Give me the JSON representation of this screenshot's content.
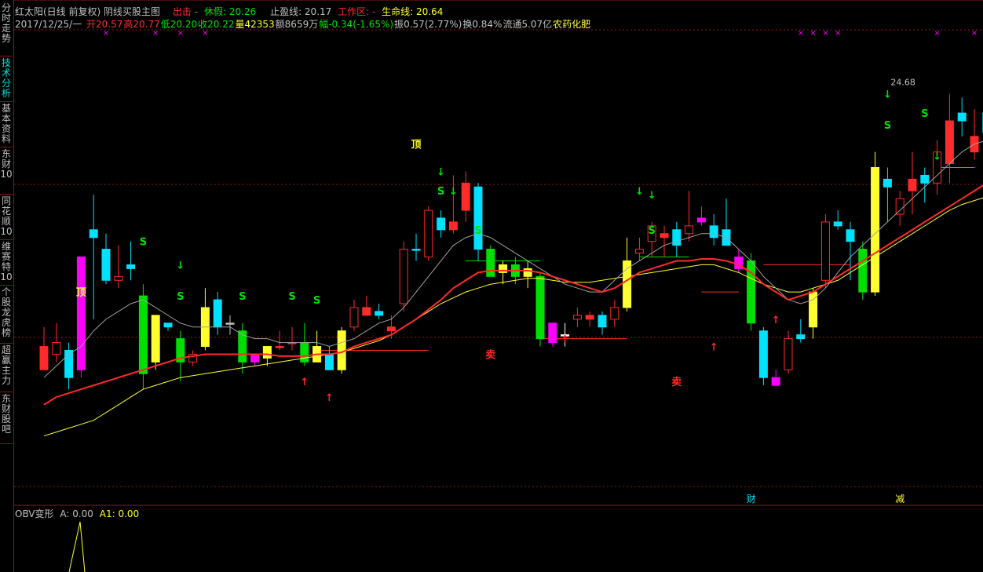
{
  "colors": {
    "red": "#ff2a2a",
    "yellow": "#ffff30",
    "green": "#00e000",
    "cyan": "#00e0ff",
    "magenta": "#ff00ff",
    "white": "#ffffff",
    "grey": "#c0c0c0",
    "axis": "#8a1a1a",
    "darkred": "#cc2020"
  },
  "sidebar": {
    "tabs": [
      "分时走势",
      "技术分析",
      "基本资料",
      "东财10",
      "同花顺10",
      "维赛特10",
      "个股龙虎榜",
      "超赢主力",
      "东财股吧"
    ],
    "active_index": 1
  },
  "header": {
    "title": "红太阳(日线 前复权) 阴线买股主图",
    "exit_label": "出击",
    "dash": "-",
    "rest_label": "休假: 20.26",
    "stop_label": "止盈线: 20.17",
    "work_label": "工作区: -",
    "life_label": "生命线: 20.64",
    "date": "2017/12/25/一",
    "open": "开20.57",
    "high": "高20.77",
    "low": "低20.20",
    "close": "收20.22",
    "vol": "量42353",
    "amount": "额8659万",
    "change": "幅-0.34(-1.65%)",
    "amp": "振0.57(2.77%)",
    "turnover": "换0.84%",
    "float": "流通5.07亿",
    "sector": "农药化肥"
  },
  "indicator": {
    "label": "OBV变形",
    "a": "A: 0.00",
    "a1": "A1: 0.00"
  },
  "chart_data": {
    "type": "candlestick",
    "title": "红太阳(日线 前复权) 阴线买股主图",
    "ylim": [
      14.2,
      25.9
    ],
    "max_label": "24.68",
    "candles": [
      {
        "o": 17.8,
        "h": 18.3,
        "l": 17.4,
        "c": 17.2,
        "col": "red"
      },
      {
        "o": 17.6,
        "h": 18.4,
        "l": 17.4,
        "c": 17.9,
        "col": "red"
      },
      {
        "o": 17.7,
        "h": 17.9,
        "l": 16.7,
        "c": 17.0,
        "col": "cyan"
      },
      {
        "o": 17.2,
        "h": 17.3,
        "l": 17.0,
        "c": 20.1,
        "col": "magenta"
      },
      {
        "o": 20.8,
        "h": 21.7,
        "l": 18.5,
        "c": 20.6,
        "col": "cyan"
      },
      {
        "o": 20.3,
        "h": 20.7,
        "l": 19.4,
        "c": 19.5,
        "col": "cyan"
      },
      {
        "o": 19.5,
        "h": 20.4,
        "l": 19.3,
        "c": 19.6,
        "col": "red"
      },
      {
        "o": 19.8,
        "h": 20.5,
        "l": 19.5,
        "c": 19.9,
        "col": "cyan"
      },
      {
        "o": 19.1,
        "h": 19.4,
        "l": 16.7,
        "c": 17.1,
        "col": "green"
      },
      {
        "o": 18.6,
        "h": 18.6,
        "l": 17.2,
        "c": 17.4,
        "col": "yellow"
      },
      {
        "o": 18.4,
        "h": 18.4,
        "l": 18.2,
        "c": 18.3,
        "col": "cyan"
      },
      {
        "o": 18.0,
        "h": 18.2,
        "l": 16.9,
        "c": 17.4,
        "col": "green"
      },
      {
        "o": 17.4,
        "h": 17.7,
        "l": 17.3,
        "c": 17.6,
        "col": "red"
      },
      {
        "o": 17.8,
        "h": 19.3,
        "l": 17.7,
        "c": 18.8,
        "col": "yellow"
      },
      {
        "o": 19.0,
        "h": 19.2,
        "l": 18.1,
        "c": 18.3,
        "col": "cyan"
      },
      {
        "o": 18.4,
        "h": 18.6,
        "l": 18.1,
        "c": 18.4,
        "col": "grey"
      },
      {
        "o": 18.2,
        "h": 18.4,
        "l": 17.1,
        "c": 17.4,
        "col": "green"
      },
      {
        "o": 17.6,
        "h": 17.6,
        "l": 17.3,
        "c": 17.4,
        "col": "magenta"
      },
      {
        "o": 17.5,
        "h": 17.7,
        "l": 17.3,
        "c": 17.8,
        "col": "yellow"
      },
      {
        "o": 17.8,
        "h": 18.2,
        "l": 17.7,
        "c": 17.8,
        "col": "red"
      },
      {
        "o": 17.9,
        "h": 18.3,
        "l": 17.7,
        "c": 17.9,
        "col": "red"
      },
      {
        "o": 17.9,
        "h": 18.4,
        "l": 17.3,
        "c": 17.4,
        "col": "green"
      },
      {
        "o": 17.8,
        "h": 18.2,
        "l": 17.4,
        "c": 17.4,
        "col": "yellow"
      },
      {
        "o": 17.6,
        "h": 17.8,
        "l": 17.2,
        "c": 17.2,
        "col": "cyan"
      },
      {
        "o": 17.2,
        "h": 18.3,
        "l": 17.1,
        "c": 18.2,
        "col": "yellow"
      },
      {
        "o": 18.3,
        "h": 19.0,
        "l": 18.2,
        "c": 18.8,
        "col": "red"
      },
      {
        "o": 18.8,
        "h": 19.1,
        "l": 18.6,
        "c": 18.6,
        "col": "red"
      },
      {
        "o": 18.6,
        "h": 18.9,
        "l": 18.5,
        "c": 18.7,
        "col": "cyan"
      },
      {
        "o": 18.3,
        "h": 18.6,
        "l": 18.0,
        "c": 18.2,
        "col": "red"
      },
      {
        "o": 18.9,
        "h": 20.5,
        "l": 18.7,
        "c": 20.3,
        "col": "red"
      },
      {
        "o": 20.3,
        "h": 20.7,
        "l": 20.0,
        "c": 20.3,
        "col": "cyan"
      },
      {
        "o": 20.1,
        "h": 21.4,
        "l": 20.0,
        "c": 21.3,
        "col": "red"
      },
      {
        "o": 21.1,
        "h": 21.3,
        "l": 20.6,
        "c": 20.8,
        "col": "cyan"
      },
      {
        "o": 21.0,
        "h": 22.2,
        "l": 20.7,
        "c": 20.8,
        "col": "red"
      },
      {
        "o": 22.0,
        "h": 22.3,
        "l": 21.0,
        "c": 21.3,
        "col": "red"
      },
      {
        "o": 21.9,
        "h": 22.0,
        "l": 20.0,
        "c": 20.3,
        "col": "cyan"
      },
      {
        "o": 20.3,
        "h": 20.4,
        "l": 19.6,
        "c": 19.6,
        "col": "green"
      },
      {
        "o": 19.9,
        "h": 20.0,
        "l": 19.4,
        "c": 19.7,
        "col": "yellow"
      },
      {
        "o": 19.9,
        "h": 20.1,
        "l": 19.4,
        "c": 19.6,
        "col": "green"
      },
      {
        "o": 19.8,
        "h": 20.0,
        "l": 19.3,
        "c": 19.6,
        "col": "yellow"
      },
      {
        "o": 19.6,
        "h": 19.7,
        "l": 17.8,
        "c": 18.0,
        "col": "green"
      },
      {
        "o": 18.4,
        "h": 18.4,
        "l": 17.8,
        "c": 17.9,
        "col": "magenta"
      },
      {
        "o": 18.1,
        "h": 18.4,
        "l": 17.8,
        "c": 18.1,
        "col": "white"
      },
      {
        "o": 18.5,
        "h": 18.8,
        "l": 18.3,
        "c": 18.6,
        "col": "red"
      },
      {
        "o": 18.6,
        "h": 18.7,
        "l": 18.3,
        "c": 18.5,
        "col": "red"
      },
      {
        "o": 18.3,
        "h": 18.7,
        "l": 18.1,
        "c": 18.6,
        "col": "cyan"
      },
      {
        "o": 18.5,
        "h": 19.0,
        "l": 18.3,
        "c": 18.8,
        "col": "red"
      },
      {
        "o": 18.8,
        "h": 20.6,
        "l": 18.7,
        "c": 20.0,
        "col": "yellow"
      },
      {
        "o": 20.2,
        "h": 20.6,
        "l": 20.0,
        "c": 20.3,
        "col": "red"
      },
      {
        "o": 20.5,
        "h": 21.0,
        "l": 20.1,
        "c": 20.9,
        "col": "red"
      },
      {
        "o": 20.7,
        "h": 20.9,
        "l": 20.1,
        "c": 20.6,
        "col": "red"
      },
      {
        "o": 20.8,
        "h": 21.0,
        "l": 20.1,
        "c": 20.4,
        "col": "cyan"
      },
      {
        "o": 20.7,
        "h": 21.8,
        "l": 20.5,
        "c": 20.9,
        "col": "red"
      },
      {
        "o": 21.1,
        "h": 21.4,
        "l": 20.9,
        "c": 21.0,
        "col": "magenta"
      },
      {
        "o": 20.9,
        "h": 21.2,
        "l": 20.4,
        "c": 20.6,
        "col": "cyan"
      },
      {
        "o": 20.8,
        "h": 21.6,
        "l": 20.4,
        "c": 20.4,
        "col": "cyan"
      },
      {
        "o": 20.1,
        "h": 20.3,
        "l": 19.7,
        "c": 19.8,
        "col": "magenta"
      },
      {
        "o": 20.0,
        "h": 20.2,
        "l": 18.2,
        "c": 18.4,
        "col": "green"
      },
      {
        "o": 18.2,
        "h": 18.3,
        "l": 16.8,
        "c": 17.0,
        "col": "cyan"
      },
      {
        "o": 17.0,
        "h": 17.2,
        "l": 16.8,
        "c": 16.8,
        "col": "magenta"
      },
      {
        "o": 17.2,
        "h": 18.2,
        "l": 17.1,
        "c": 18.0,
        "col": "red"
      },
      {
        "o": 18.1,
        "h": 18.5,
        "l": 17.9,
        "c": 18.0,
        "col": "cyan"
      },
      {
        "o": 18.3,
        "h": 19.3,
        "l": 18.0,
        "c": 19.2,
        "col": "yellow"
      },
      {
        "o": 19.5,
        "h": 21.2,
        "l": 19.3,
        "c": 21.0,
        "col": "red"
      },
      {
        "o": 21.0,
        "h": 21.3,
        "l": 20.8,
        "c": 20.9,
        "col": "cyan"
      },
      {
        "o": 20.8,
        "h": 21.0,
        "l": 19.5,
        "c": 20.5,
        "col": "cyan"
      },
      {
        "o": 20.3,
        "h": 20.5,
        "l": 19.0,
        "c": 19.2,
        "col": "green"
      },
      {
        "o": 19.2,
        "h": 22.8,
        "l": 19.1,
        "c": 22.4,
        "col": "yellow"
      },
      {
        "o": 22.1,
        "h": 22.4,
        "l": 21.0,
        "c": 21.9,
        "col": "cyan"
      },
      {
        "o": 21.2,
        "h": 21.8,
        "l": 20.9,
        "c": 21.6,
        "col": "red"
      },
      {
        "o": 22.1,
        "h": 22.8,
        "l": 21.2,
        "c": 21.8,
        "col": "red"
      },
      {
        "o": 22.2,
        "h": 22.4,
        "l": 21.5,
        "c": 22.0,
        "col": "cyan"
      },
      {
        "o": 22.0,
        "h": 23.1,
        "l": 21.7,
        "c": 22.8,
        "col": "red"
      },
      {
        "o": 23.6,
        "h": 24.3,
        "l": 22.0,
        "c": 22.5,
        "col": "red"
      },
      {
        "o": 23.8,
        "h": 24.2,
        "l": 23.2,
        "c": 23.6,
        "col": "cyan"
      },
      {
        "o": 23.2,
        "h": 23.9,
        "l": 22.6,
        "c": 22.8,
        "col": "red"
      },
      {
        "o": 23.8,
        "h": 24.68,
        "l": 23.1,
        "c": 23.3,
        "col": "cyan"
      },
      {
        "o": 22.5,
        "h": 23.6,
        "l": 22.3,
        "c": 22.9,
        "col": "red"
      },
      {
        "o": 23.6,
        "h": 23.7,
        "l": 22.5,
        "c": 22.8,
        "col": "red"
      },
      {
        "o": 23.9,
        "h": 24.0,
        "l": 22.2,
        "c": 22.4,
        "col": "cyan"
      },
      {
        "o": 22.8,
        "h": 22.8,
        "l": 22.3,
        "c": 22.5,
        "col": "green"
      },
      {
        "o": 22.5,
        "h": 22.6,
        "l": 22.0,
        "c": 22.2,
        "col": "cyan"
      },
      {
        "o": 22.3,
        "h": 22.5,
        "l": 19.7,
        "c": 22.4,
        "col": "red"
      },
      {
        "o": 22.2,
        "h": 22.9,
        "l": 22.1,
        "c": 22.8,
        "col": "magenta"
      },
      {
        "o": 22.9,
        "h": 23.1,
        "l": 22.3,
        "c": 22.4,
        "col": "green"
      },
      {
        "o": 22.6,
        "h": 23.4,
        "l": 20.1,
        "c": 20.2,
        "col": "cyan"
      }
    ],
    "ma_red": [
      16.3,
      16.5,
      16.6,
      16.7,
      16.8,
      16.9,
      17.0,
      17.1,
      17.2,
      17.3,
      17.4,
      17.5,
      17.55,
      17.6,
      17.6,
      17.6,
      17.6,
      17.6,
      17.6,
      17.55,
      17.55,
      17.55,
      17.6,
      17.6,
      17.65,
      17.8,
      17.9,
      18.0,
      18.1,
      18.3,
      18.5,
      18.75,
      19.0,
      19.3,
      19.5,
      19.7,
      19.75,
      19.75,
      19.75,
      19.75,
      19.7,
      19.6,
      19.5,
      19.4,
      19.3,
      19.2,
      19.3,
      19.5,
      19.7,
      19.8,
      19.9,
      20.0,
      20.0,
      20.05,
      20.05,
      20.0,
      19.9,
      19.7,
      19.4,
      19.2,
      19.0,
      19.1,
      19.2,
      19.4,
      19.6,
      19.8,
      20.0,
      20.2,
      20.4,
      20.6,
      20.8,
      21.0,
      21.2,
      21.4,
      21.6,
      21.8,
      22.0,
      22.2,
      22.35,
      22.4,
      22.4,
      22.4,
      22.3,
      22.2,
      22.1
    ],
    "ma_grey": [
      17.0,
      17.3,
      17.6,
      17.8,
      18.2,
      18.5,
      18.7,
      18.9,
      19.0,
      18.8,
      18.6,
      18.4,
      18.3,
      18.3,
      18.3,
      18.3,
      18.1,
      18.0,
      18.0,
      17.9,
      17.9,
      17.9,
      17.9,
      17.8,
      17.9,
      18.0,
      18.2,
      18.4,
      18.5,
      18.8,
      19.2,
      19.6,
      20.0,
      20.4,
      20.6,
      20.7,
      20.6,
      20.4,
      20.2,
      20.0,
      19.8,
      19.6,
      19.4,
      19.3,
      19.2,
      19.2,
      19.5,
      19.8,
      20.0,
      20.2,
      20.4,
      20.5,
      20.6,
      20.7,
      20.7,
      20.6,
      20.3,
      20.0,
      19.6,
      19.3,
      19.0,
      18.9,
      19.0,
      19.3,
      19.7,
      20.1,
      20.4,
      20.7,
      21.0,
      21.3,
      21.6,
      21.9,
      22.2,
      22.5,
      22.8,
      23.0,
      23.1,
      23.2,
      23.4,
      23.3,
      23.1,
      22.9,
      22.9,
      22.7,
      22.5
    ],
    "ma_yellow": [
      15.5,
      15.6,
      15.7,
      15.8,
      15.9,
      16.1,
      16.3,
      16.5,
      16.7,
      16.8,
      16.9,
      17.0,
      17.05,
      17.1,
      17.15,
      17.2,
      17.25,
      17.3,
      17.35,
      17.4,
      17.45,
      17.5,
      17.55,
      17.6,
      17.65,
      17.75,
      17.85,
      17.95,
      18.1,
      18.3,
      18.5,
      18.7,
      18.9,
      19.05,
      19.2,
      19.3,
      19.4,
      19.45,
      19.5,
      19.55,
      19.55,
      19.5,
      19.45,
      19.45,
      19.45,
      19.5,
      19.55,
      19.6,
      19.65,
      19.7,
      19.75,
      19.8,
      19.85,
      19.9,
      19.9,
      19.8,
      19.7,
      19.55,
      19.4,
      19.3,
      19.2,
      19.2,
      19.3,
      19.4,
      19.5,
      19.7,
      19.9,
      20.1,
      20.3,
      20.5,
      20.7,
      20.9,
      21.1,
      21.3,
      21.45,
      21.55,
      21.65,
      21.75,
      21.8,
      21.85,
      21.9,
      21.95,
      21.9,
      21.85,
      21.8
    ],
    "labels": [
      {
        "text": "顶",
        "i": 3,
        "y": 19.1,
        "color": "yellow"
      },
      {
        "text": "S",
        "i": 8,
        "y": 20.4,
        "color": "green"
      },
      {
        "text": "↓",
        "i": 11,
        "y": 19.8,
        "color": "green"
      },
      {
        "text": "S",
        "i": 11,
        "y": 19.0,
        "color": "green"
      },
      {
        "text": "S",
        "i": 16,
        "y": 19.0,
        "color": "green"
      },
      {
        "text": "S",
        "i": 20,
        "y": 19.0,
        "color": "green"
      },
      {
        "text": "S",
        "i": 22,
        "y": 18.9,
        "color": "green"
      },
      {
        "text": "↑",
        "i": 21,
        "y": 16.8,
        "color": "red"
      },
      {
        "text": "↑",
        "i": 23,
        "y": 16.4,
        "color": "red"
      },
      {
        "text": "顶",
        "i": 30,
        "y": 22.9,
        "color": "yellow"
      },
      {
        "text": "↓",
        "i": 32,
        "y": 22.2,
        "color": "green"
      },
      {
        "text": "S",
        "i": 32,
        "y": 21.7,
        "color": "green"
      },
      {
        "text": "↓",
        "i": 33,
        "y": 21.7,
        "color": "green"
      },
      {
        "text": "S",
        "i": 35,
        "y": 20.7,
        "color": "green"
      },
      {
        "text": "卖",
        "i": 36,
        "y": 17.5,
        "color": "red"
      },
      {
        "text": "↑",
        "i": 42,
        "y": 17.9,
        "color": "red"
      },
      {
        "text": "↓",
        "i": 48,
        "y": 21.7,
        "color": "green"
      },
      {
        "text": "↓",
        "i": 49,
        "y": 21.6,
        "color": "green"
      },
      {
        "text": "S",
        "i": 49,
        "y": 20.7,
        "color": "green"
      },
      {
        "text": "卖",
        "i": 51,
        "y": 16.8,
        "color": "red"
      },
      {
        "text": "↑",
        "i": 54,
        "y": 17.7,
        "color": "red"
      },
      {
        "text": "↑",
        "i": 59,
        "y": 18.4,
        "color": "red"
      },
      {
        "text": "↓",
        "i": 68,
        "y": 24.2,
        "color": "green"
      },
      {
        "text": "S",
        "i": 68,
        "y": 23.4,
        "color": "green"
      },
      {
        "text": "S",
        "i": 71,
        "y": 23.7,
        "color": "green"
      },
      {
        "text": "↓",
        "i": 72,
        "y": 22.6,
        "color": "green"
      }
    ],
    "hlines": [
      {
        "y": 17.7,
        "from": 22,
        "to": 31,
        "color": "red"
      },
      {
        "y": 20.0,
        "from": 34,
        "to": 40,
        "color": "green"
      },
      {
        "y": 18.0,
        "from": 40,
        "to": 47,
        "color": "red"
      },
      {
        "y": 20.1,
        "from": 48,
        "to": 52,
        "color": "green"
      },
      {
        "y": 19.2,
        "from": 53,
        "to": 56,
        "color": "red"
      },
      {
        "y": 19.9,
        "from": 58,
        "to": 65,
        "color": "red"
      },
      {
        "y": 22.4,
        "from": 72,
        "to": 75,
        "color": "green"
      }
    ],
    "bottom_labels": [
      {
        "text": "财",
        "i": 57,
        "color": "cyan"
      },
      {
        "text": "减",
        "i": 69,
        "color": "yellow"
      }
    ]
  }
}
